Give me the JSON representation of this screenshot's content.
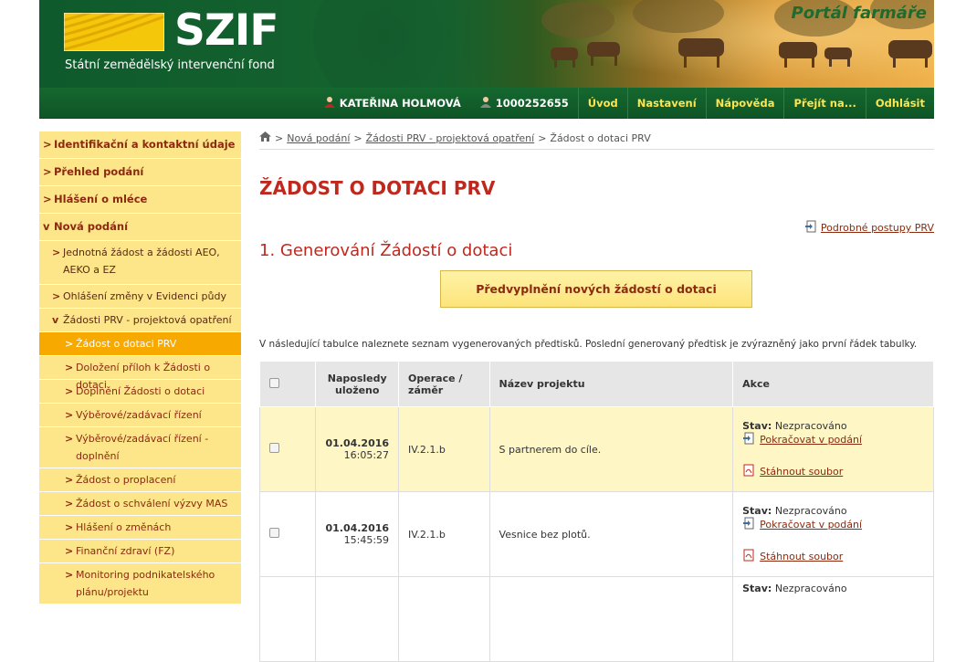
{
  "header": {
    "logo_text": "SZIF",
    "logo_subtitle": "Státní zemědělský intervenční fond",
    "portal_name": "Portál farmáře"
  },
  "topbar": {
    "user_name": "KATEŘINA HOLMOVÁ",
    "client_id": "1000252655",
    "items": [
      "Úvod",
      "Nastavení",
      "Nápověda",
      "Přejít na...",
      "Odhlásit"
    ]
  },
  "sidebar": {
    "items": [
      {
        "label": "Identifikační a kontaktní údaje",
        "chev": ">"
      },
      {
        "label": "Přehled podání",
        "chev": ">"
      },
      {
        "label": "Hlášení o mléce",
        "chev": ">"
      },
      {
        "label": "Nová podání",
        "chev": "v"
      },
      {
        "label": "Jednotná žádost a žádosti AEO, AEKO a EZ",
        "chev": ">"
      },
      {
        "label": "Ohlášení změny v Evidenci půdy",
        "chev": ">"
      },
      {
        "label": "Žádosti PRV - projektová opatření",
        "chev": "v"
      },
      {
        "label": "Žádost o dotaci PRV",
        "chev": ">"
      },
      {
        "label": "Doložení příloh k Žádosti o dotaci",
        "chev": ">"
      },
      {
        "label": "Doplnění Žádosti o dotaci",
        "chev": ">"
      },
      {
        "label": "Výběrové/zadávací řízení",
        "chev": ">"
      },
      {
        "label": "Výběrové/zadávací řízení - doplnění",
        "chev": ">"
      },
      {
        "label": "Žádost o proplacení",
        "chev": ">"
      },
      {
        "label": "Žádost o schválení výzvy MAS",
        "chev": ">"
      },
      {
        "label": "Hlášení o změnách",
        "chev": ">"
      },
      {
        "label": "Finanční zdraví (FZ)",
        "chev": ">"
      },
      {
        "label": "Monitoring podnikatelského plánu/projektu",
        "chev": ">"
      }
    ]
  },
  "breadcrumb": {
    "sep": ">",
    "items": [
      "Nová podání",
      "Žádosti PRV - projektová opatření",
      "Žádost o dotaci PRV"
    ]
  },
  "page": {
    "title": "ŽÁDOST O DOTACI PRV",
    "guide_link": "Podrobné postupy PRV",
    "section_title": "1. Generování Žádostí o dotaci",
    "prefill_button": "Předvyplnění nových žádostí o dotaci",
    "intro": "V následující tabulce naleznete seznam vygenerovaných předtisků. Poslední generovaný předtisk je zvýrazněný jako první řádek tabulky."
  },
  "table": {
    "headers": [
      "Naposledy uloženo",
      "Operace / záměr",
      "Název projektu",
      "Akce"
    ],
    "stav_label": "Stav:",
    "continue_label": "Pokračovat v podání",
    "download_label": "Stáhnout soubor",
    "rows": [
      {
        "date": "01.04.2016",
        "time": "16:05:27",
        "operation": "IV.2.1.b",
        "project": "S partnerem do cíle.",
        "status": "Nezpracováno"
      },
      {
        "date": "01.04.2016",
        "time": "15:45:59",
        "operation": "IV.2.1.b",
        "project": "Vesnice bez plotů.",
        "status": "Nezpracováno"
      },
      {
        "date": "",
        "time": "",
        "operation": "",
        "project": "",
        "status": "Nezpracováno"
      }
    ]
  }
}
